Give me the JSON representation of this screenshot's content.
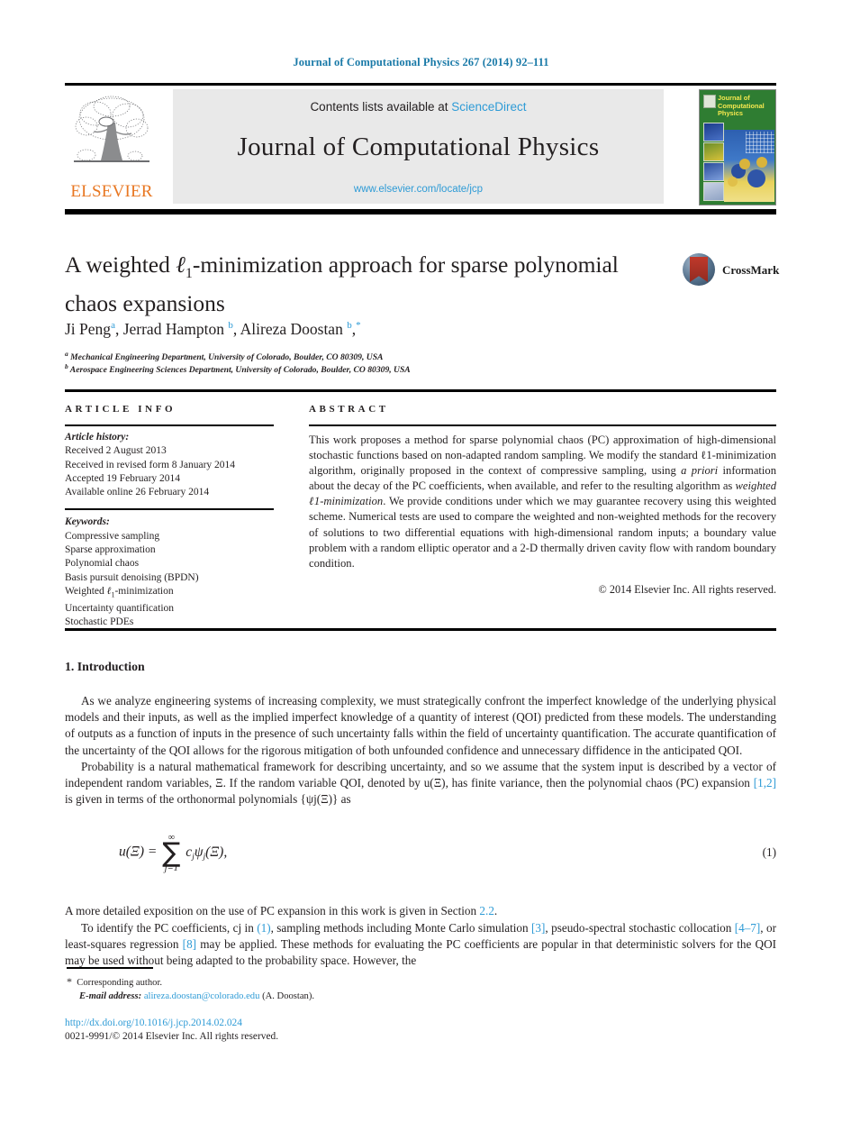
{
  "running_head": "Journal of Computational Physics 267 (2014) 92–111",
  "masthead": {
    "publisher": "ELSEVIER",
    "contents_prefix": "Contents lists available at ",
    "contents_link": "ScienceDirect",
    "journal_name": "Journal of Computational Physics",
    "journal_url": "www.elsevier.com/locate/jcp",
    "cover_title": "Journal of Computational Physics"
  },
  "article": {
    "title_line1_a": "A weighted ",
    "title_ell": "ℓ",
    "title_sub": "1",
    "title_line1_b": "-minimization approach for sparse polynomial",
    "title_line2": "chaos expansions",
    "crossmark_label": "CrossMark",
    "authors_html": "Ji Peng<sup>a</sup>, Jerrad Hampton <sup>b</sup>, Alireza Doostan <sup>b</sup>,<sup>*</sup>",
    "affiliation_a": "Mechanical Engineering Department, University of Colorado, Boulder, CO 80309, USA",
    "affiliation_b": "Aerospace Engineering Sciences Department, University of Colorado, Boulder, CO 80309, USA",
    "affiliation_a_mark": "a",
    "affiliation_b_mark": "b"
  },
  "info": {
    "heading": "ARTICLE INFO",
    "history_label": "Article history:",
    "history": [
      "Received 2 August 2013",
      "Received in revised form 8 January 2014",
      "Accepted 19 February 2014",
      "Available online 26 February 2014"
    ],
    "keywords_label": "Keywords:",
    "keywords": [
      "Compressive sampling",
      "Sparse approximation",
      "Polynomial chaos",
      "Basis pursuit denoising (BPDN)",
      "Weighted ℓ1-minimization",
      "Uncertainty quantification",
      "Stochastic PDEs"
    ]
  },
  "abstract": {
    "heading": "ABSTRACT",
    "text": "This work proposes a method for sparse polynomial chaos (PC) approximation of high-dimensional stochastic functions based on non-adapted random sampling. We modify the standard ℓ1-minimization algorithm, originally proposed in the context of compressive sampling, using a priori information about the decay of the PC coefficients, when available, and refer to the resulting algorithm as weighted ℓ1-minimization. We provide conditions under which we may guarantee recovery using this weighted scheme. Numerical tests are used to compare the weighted and non-weighted methods for the recovery of solutions to two differential equations with high-dimensional random inputs; a boundary value problem with a random elliptic operator and a 2-D thermally driven cavity flow with random boundary condition.",
    "copyright": "© 2014 Elsevier Inc. All rights reserved."
  },
  "body": {
    "section_heading": "1. Introduction",
    "paragraph_1": "As we analyze engineering systems of increasing complexity, we must strategically confront the imperfect knowledge of the underlying physical models and their inputs, as well as the implied imperfect knowledge of a quantity of interest (QOI) predicted from these models. The understanding of outputs as a function of inputs in the presence of such uncertainty falls within the field of uncertainty quantification. The accurate quantification of the uncertainty of the QOI allows for the rigorous mitigation of both unfounded confidence and unnecessary diffidence in the anticipated QOI.",
    "paragraph_2_a": "Probability is a natural mathematical framework for describing uncertainty, and so we assume that the system input is described by a vector of independent random variables, Ξ. If the random variable QOI, denoted by u(Ξ), has finite variance, then the polynomial chaos (PC) expansion ",
    "paragraph_2_ref": "[1,2]",
    "paragraph_2_b": " is given in terms of the orthonormal polynomials {ψj(Ξ)} as",
    "equation": {
      "lhs": "u(Ξ) =",
      "sigma_top": "∞",
      "sigma_bottom": "j=1",
      "rhs": "cjψj(Ξ),",
      "number": "(1)"
    },
    "paragraph_3_a": "A more detailed exposition on the use of PC expansion in this work is given in Section ",
    "paragraph_3_ref": "2.2",
    "paragraph_3_b": ".",
    "paragraph_4_a": "To identify the PC coefficients, cj in ",
    "paragraph_4_ref1": "(1)",
    "paragraph_4_b": ", sampling methods including Monte Carlo simulation ",
    "paragraph_4_ref2": "[3]",
    "paragraph_4_c": ", pseudo-spectral stochastic collocation ",
    "paragraph_4_ref3": "[4–7]",
    "paragraph_4_d": ", or least-squares regression ",
    "paragraph_4_ref4": "[8]",
    "paragraph_4_e": " may be applied. These methods for evaluating the PC coefficients are popular in that deterministic solvers for the QOI may be used without being adapted to the probability space. However, the"
  },
  "footer": {
    "star": "*",
    "corresponding": "Corresponding author.",
    "email_label": "E-mail address:",
    "email": "alireza.doostan@colorado.edu",
    "email_suffix": "(A. Doostan).",
    "doi": "http://dx.doi.org/10.1016/j.jcp.2014.02.024",
    "issn_line": "0021-9991/© 2014 Elsevier Inc. All rights reserved."
  },
  "colors": {
    "link_blue": "#2e9bd6",
    "head_blue": "#1a7aa8",
    "elsevier_orange": "#E87722",
    "band_gray": "#e9e9e9",
    "cover_green": "#2f7d32"
  }
}
